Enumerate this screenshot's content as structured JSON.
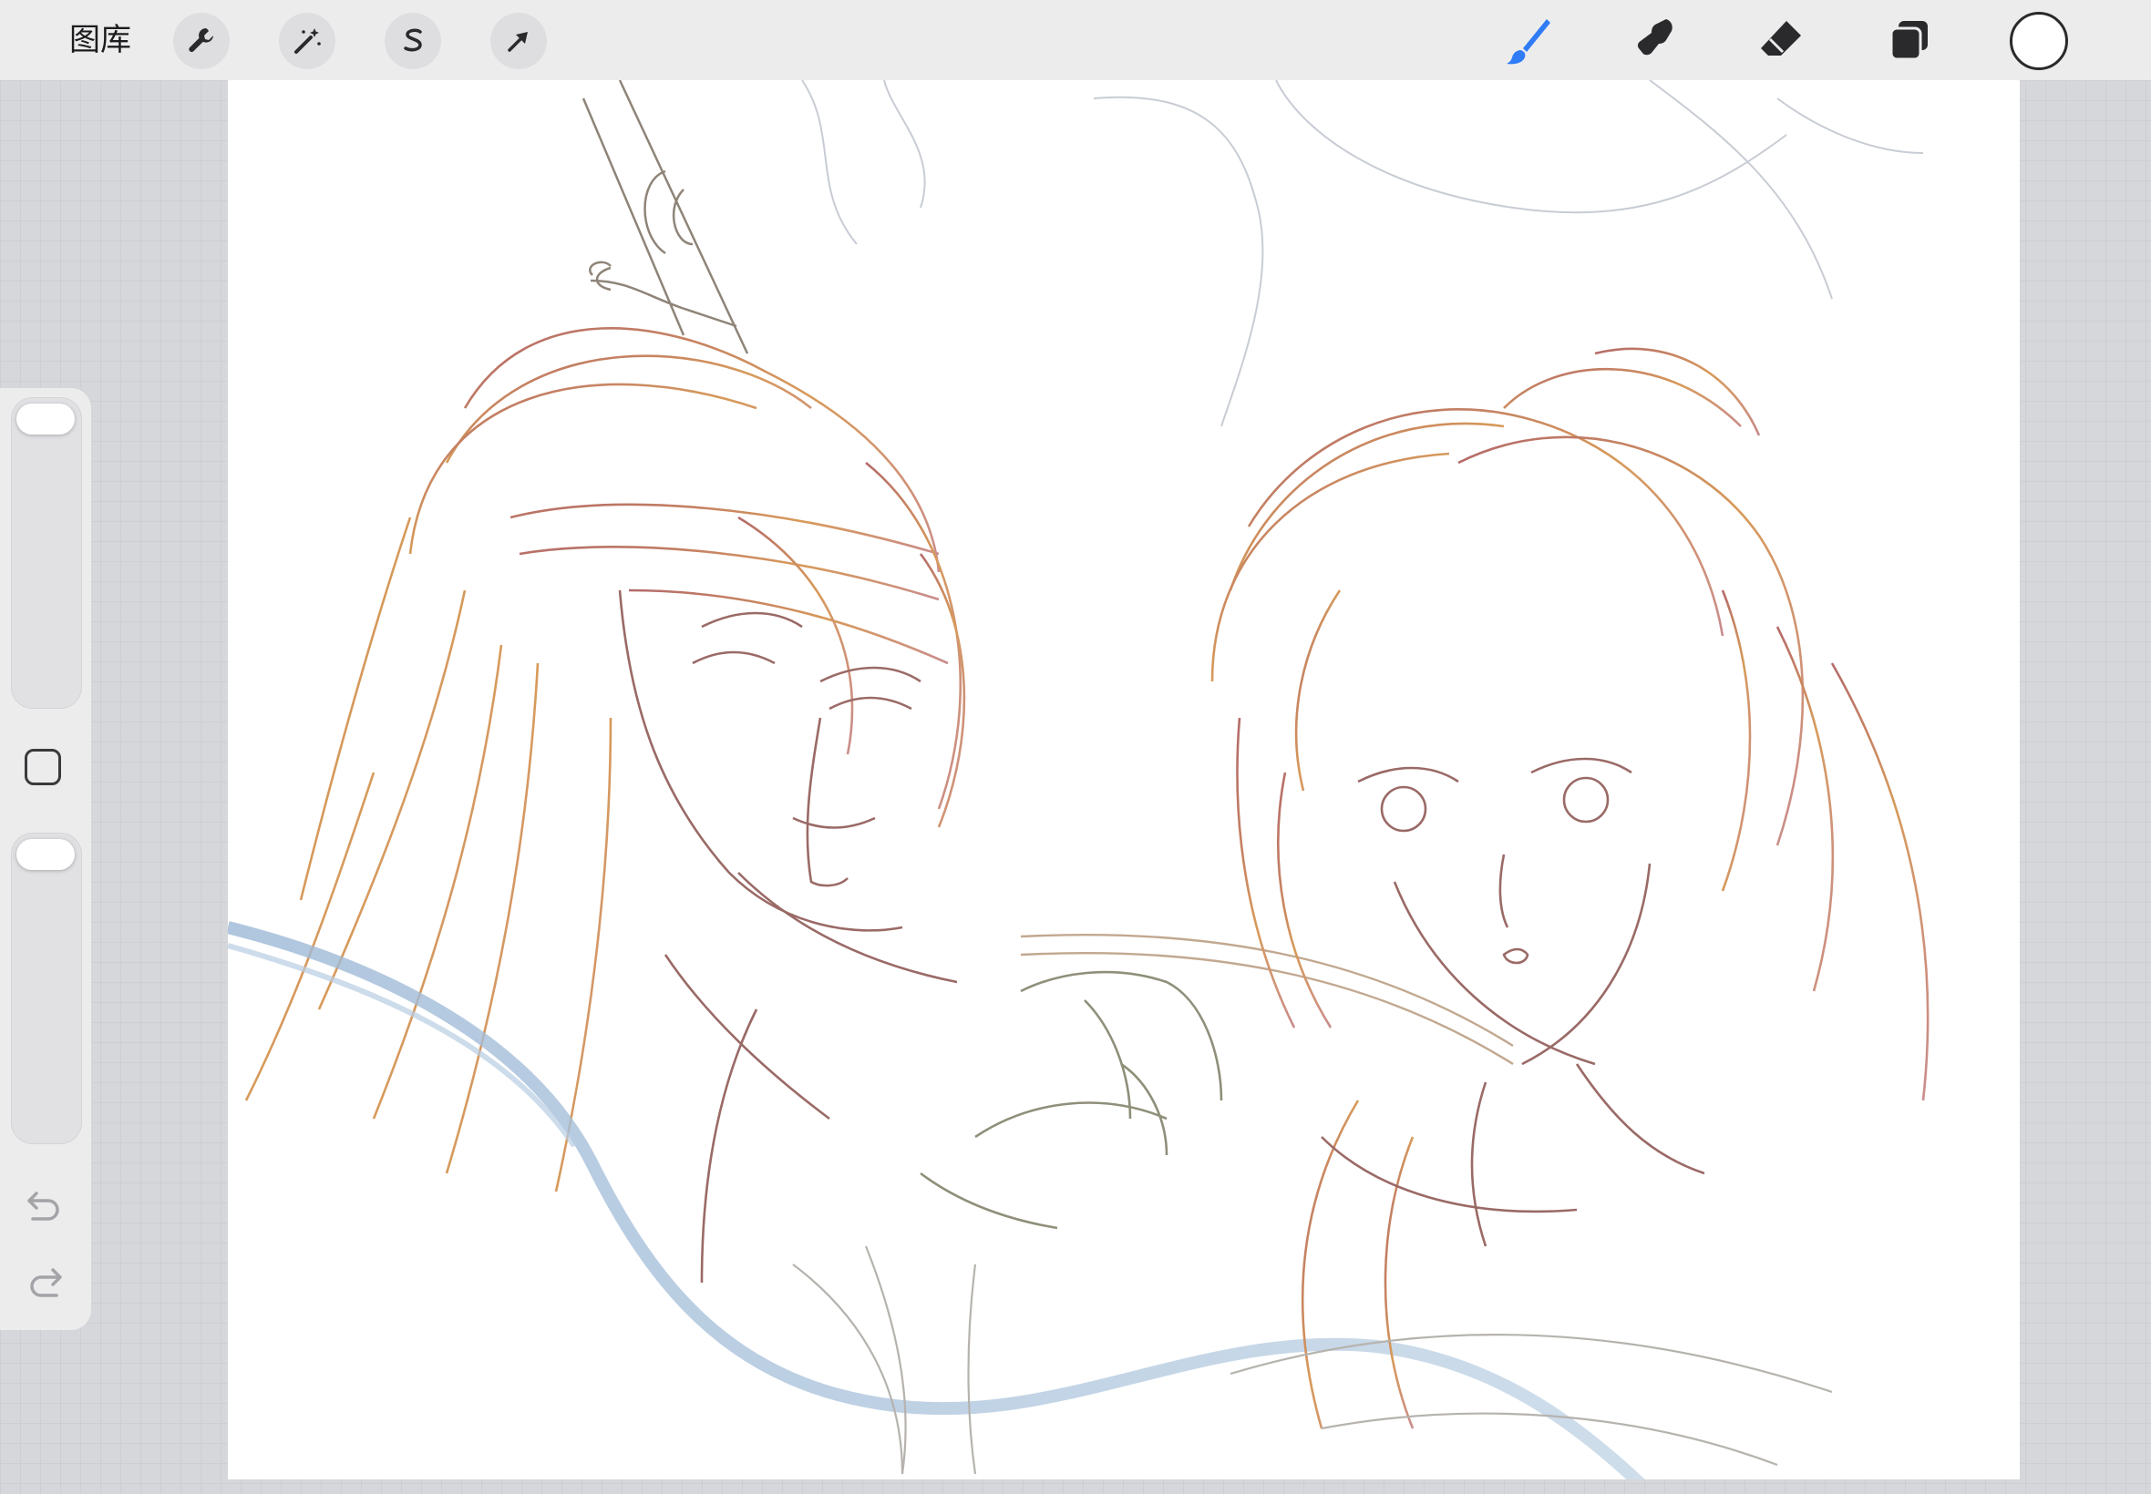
{
  "topbar": {
    "gallery_label": "图库",
    "left_tools": [
      {
        "name": "actions",
        "icon": "wrench-icon"
      },
      {
        "name": "adjustments",
        "icon": "magic-wand-icon"
      },
      {
        "name": "selection",
        "icon": "selection-s-icon"
      },
      {
        "name": "transform",
        "icon": "arrow-cursor-icon"
      }
    ],
    "right_tools": [
      {
        "name": "brush",
        "icon": "brush-icon",
        "active": true
      },
      {
        "name": "smudge",
        "icon": "smudge-finger-icon"
      },
      {
        "name": "eraser",
        "icon": "eraser-icon"
      },
      {
        "name": "layers",
        "icon": "layers-icon"
      },
      {
        "name": "color",
        "icon": "color-well",
        "value": "#ffffff"
      }
    ]
  },
  "sidebar": {
    "brush_size_level": 0.0,
    "opacity_level": 0.0,
    "modify_button": "square-modify-icon",
    "undo_icon": "undo-arrow-icon",
    "redo_icon": "redo-arrow-icon"
  },
  "colors": {
    "accent": "#2f7cf6",
    "toolbar_bg": "#ececed",
    "workspace_bg": "#d6d7da",
    "canvas_bg": "#ffffff"
  }
}
